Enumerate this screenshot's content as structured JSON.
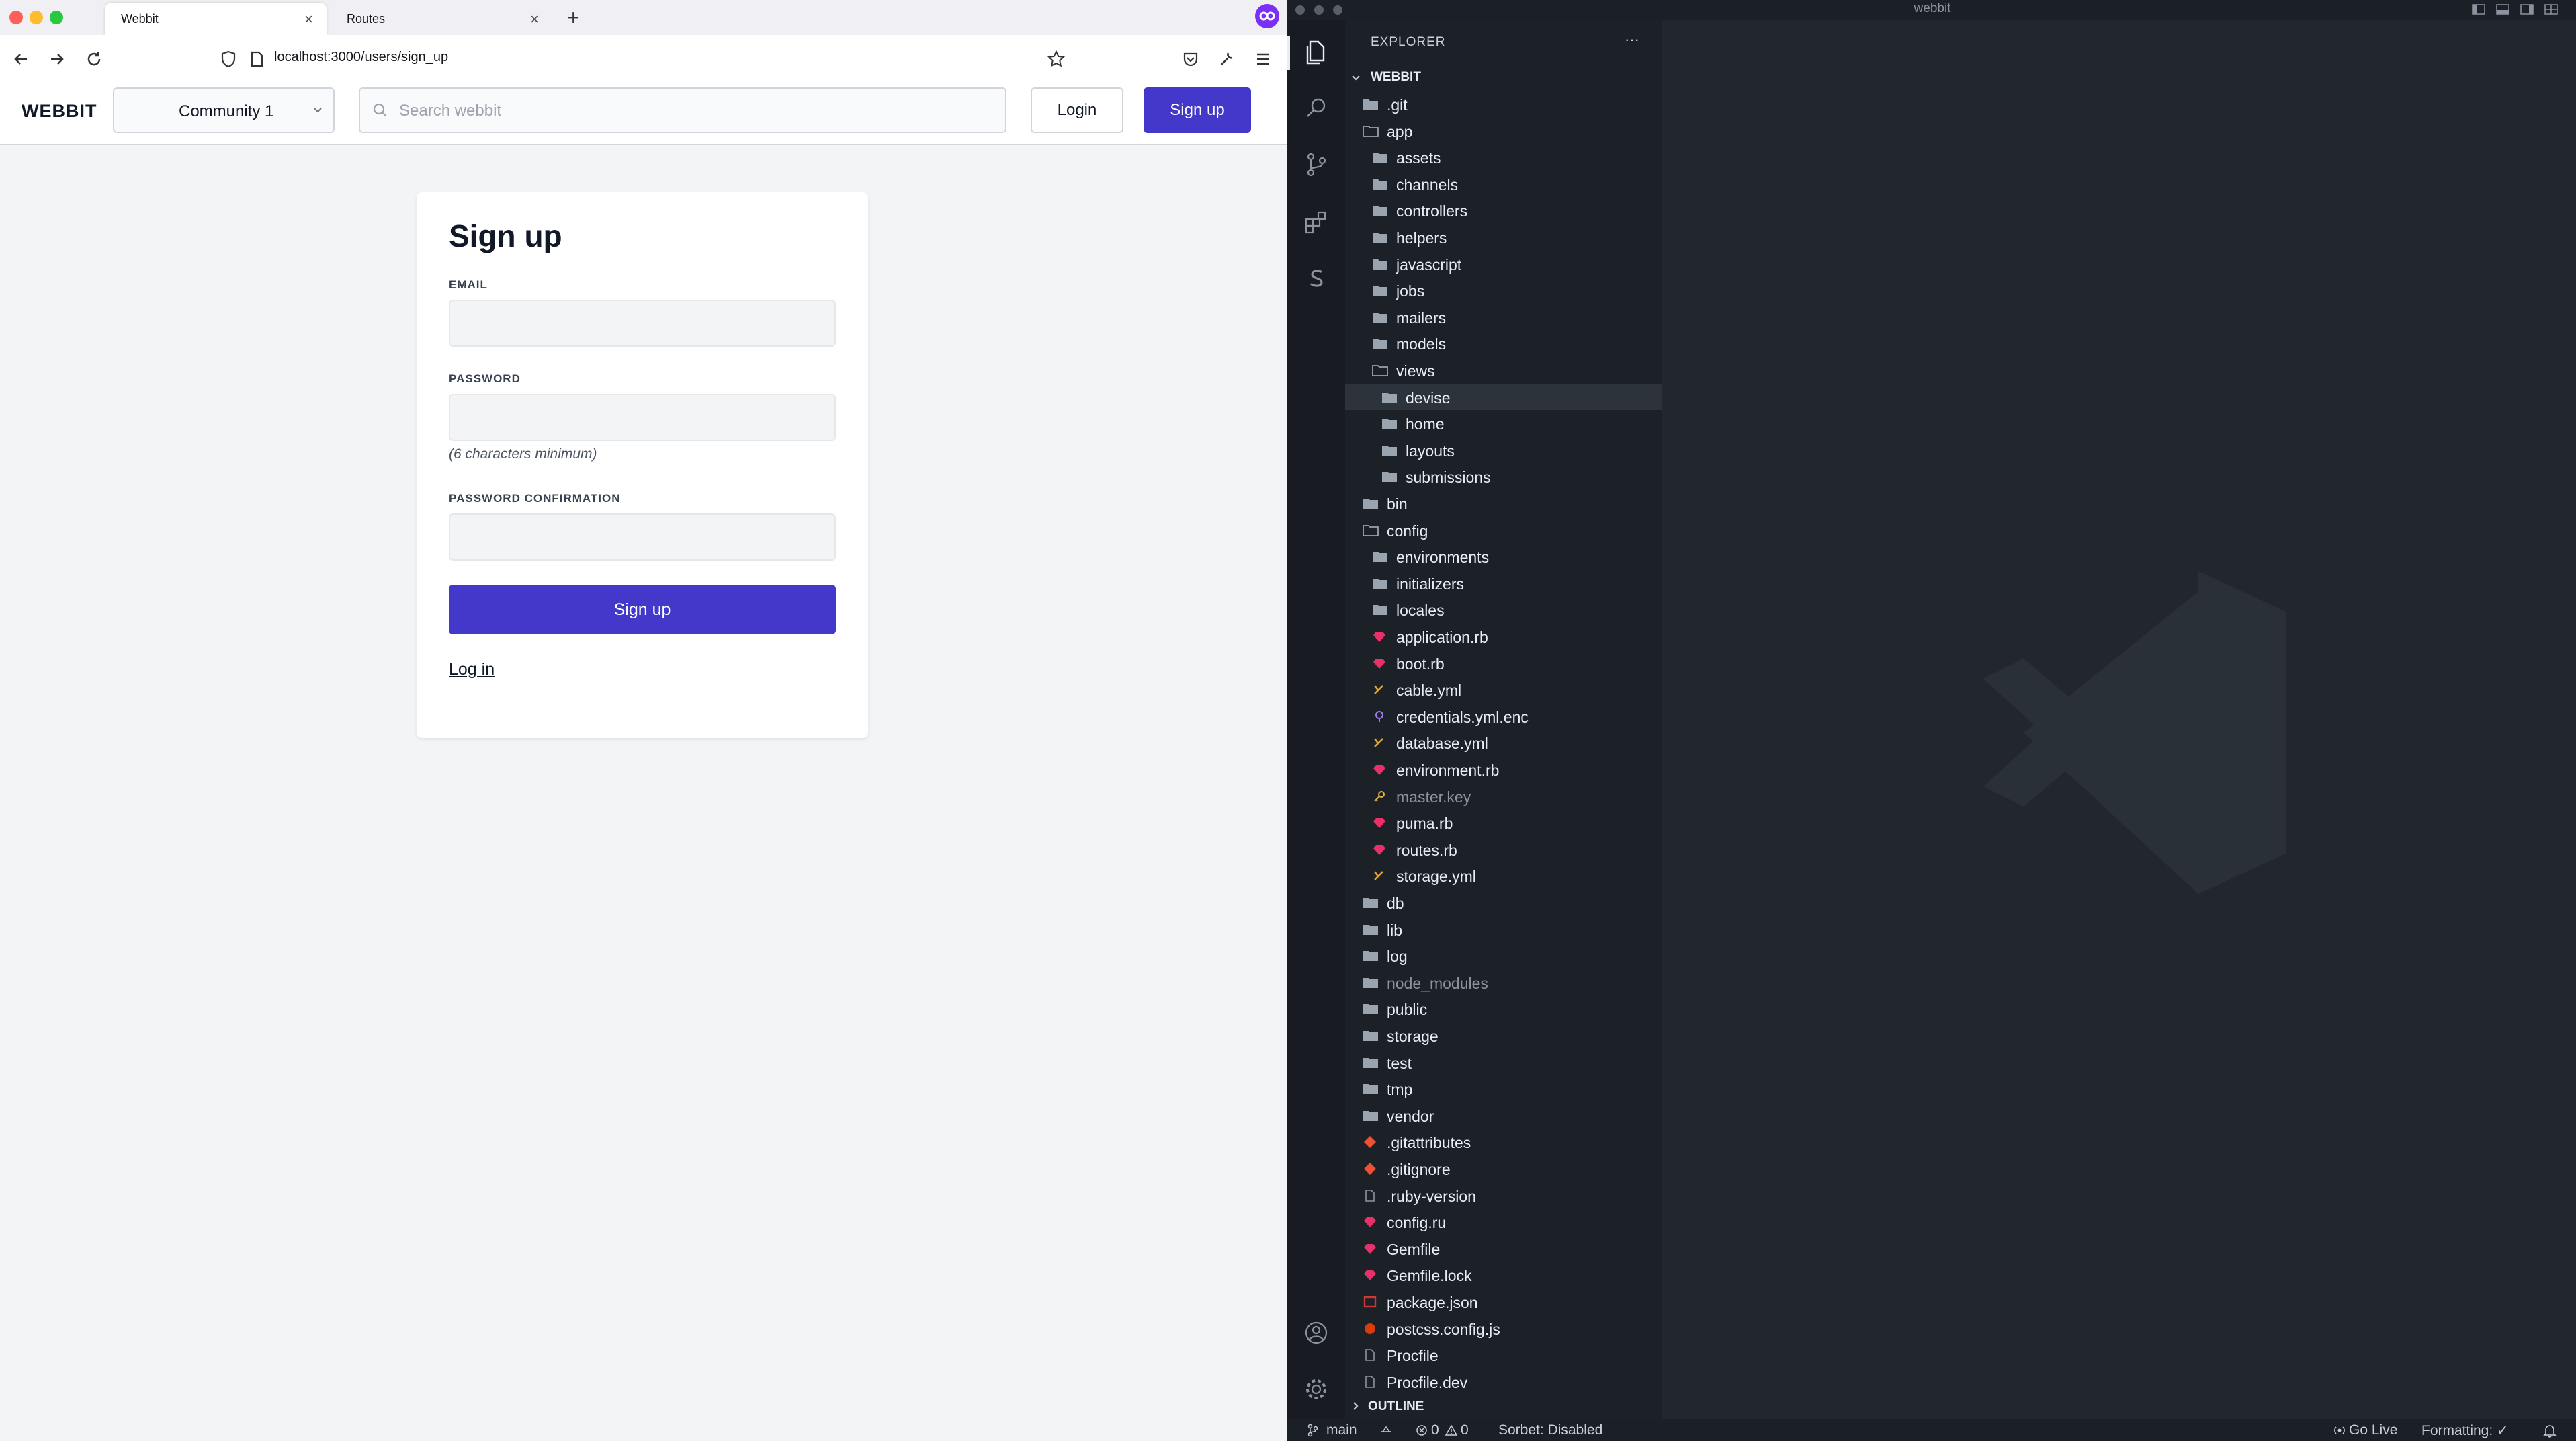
{
  "browser": {
    "tabs": [
      {
        "label": "Webbit",
        "active": true
      },
      {
        "label": "Routes",
        "active": false
      }
    ],
    "new_tab": "+",
    "url": "localhost:3000/users/sign_up"
  },
  "app": {
    "brand": "WEBBIT",
    "community_select": "Community 1",
    "search_placeholder": "Search webbit",
    "login_label": "Login",
    "signup_label": "Sign up",
    "accent_color": "#4338ca"
  },
  "form": {
    "title": "Sign up",
    "email_label": "EMAIL",
    "password_label": "PASSWORD",
    "password_hint": "(6 characters minimum)",
    "confirm_label": "PASSWORD CONFIRMATION",
    "submit_label": "Sign up",
    "login_link": "Log in"
  },
  "vscode": {
    "title": "webbit",
    "explorer_title": "EXPLORER",
    "explorer_more": "···",
    "root": "WEBBIT",
    "tree": [
      {
        "name": ".git",
        "indent": 1,
        "type": "folder"
      },
      {
        "name": "app",
        "indent": 1,
        "type": "folder-open"
      },
      {
        "name": "assets",
        "indent": 2,
        "type": "folder"
      },
      {
        "name": "channels",
        "indent": 2,
        "type": "folder"
      },
      {
        "name": "controllers",
        "indent": 2,
        "type": "folder"
      },
      {
        "name": "helpers",
        "indent": 2,
        "type": "folder"
      },
      {
        "name": "javascript",
        "indent": 2,
        "type": "folder"
      },
      {
        "name": "jobs",
        "indent": 2,
        "type": "folder"
      },
      {
        "name": "mailers",
        "indent": 2,
        "type": "folder"
      },
      {
        "name": "models",
        "indent": 2,
        "type": "folder"
      },
      {
        "name": "views",
        "indent": 2,
        "type": "folder-open"
      },
      {
        "name": "devise",
        "indent": 3,
        "type": "folder",
        "selected": true
      },
      {
        "name": "home",
        "indent": 3,
        "type": "folder"
      },
      {
        "name": "layouts",
        "indent": 3,
        "type": "folder"
      },
      {
        "name": "submissions",
        "indent": 3,
        "type": "folder"
      },
      {
        "name": "bin",
        "indent": 1,
        "type": "folder"
      },
      {
        "name": "config",
        "indent": 1,
        "type": "folder-open"
      },
      {
        "name": "environments",
        "indent": 2,
        "type": "folder"
      },
      {
        "name": "initializers",
        "indent": 2,
        "type": "folder"
      },
      {
        "name": "locales",
        "indent": 2,
        "type": "folder"
      },
      {
        "name": "application.rb",
        "indent": 2,
        "type": "ruby"
      },
      {
        "name": "boot.rb",
        "indent": 2,
        "type": "ruby"
      },
      {
        "name": "cable.yml",
        "indent": 2,
        "type": "yaml"
      },
      {
        "name": "credentials.yml.enc",
        "indent": 2,
        "type": "enc"
      },
      {
        "name": "database.yml",
        "indent": 2,
        "type": "yaml"
      },
      {
        "name": "environment.rb",
        "indent": 2,
        "type": "ruby"
      },
      {
        "name": "master.key",
        "indent": 2,
        "type": "key",
        "dim": true
      },
      {
        "name": "puma.rb",
        "indent": 2,
        "type": "ruby"
      },
      {
        "name": "routes.rb",
        "indent": 2,
        "type": "ruby"
      },
      {
        "name": "storage.yml",
        "indent": 2,
        "type": "yaml"
      },
      {
        "name": "db",
        "indent": 1,
        "type": "folder"
      },
      {
        "name": "lib",
        "indent": 1,
        "type": "folder"
      },
      {
        "name": "log",
        "indent": 1,
        "type": "folder"
      },
      {
        "name": "node_modules",
        "indent": 1,
        "type": "folder",
        "dim": true
      },
      {
        "name": "public",
        "indent": 1,
        "type": "folder"
      },
      {
        "name": "storage",
        "indent": 1,
        "type": "folder"
      },
      {
        "name": "test",
        "indent": 1,
        "type": "folder"
      },
      {
        "name": "tmp",
        "indent": 1,
        "type": "folder"
      },
      {
        "name": "vendor",
        "indent": 1,
        "type": "folder"
      },
      {
        "name": ".gitattributes",
        "indent": 1,
        "type": "git"
      },
      {
        "name": ".gitignore",
        "indent": 1,
        "type": "git"
      },
      {
        "name": ".ruby-version",
        "indent": 1,
        "type": "file"
      },
      {
        "name": "config.ru",
        "indent": 1,
        "type": "ruby"
      },
      {
        "name": "Gemfile",
        "indent": 1,
        "type": "gem"
      },
      {
        "name": "Gemfile.lock",
        "indent": 1,
        "type": "gem"
      },
      {
        "name": "package.json",
        "indent": 1,
        "type": "npm"
      },
      {
        "name": "postcss.config.js",
        "indent": 1,
        "type": "postcss"
      },
      {
        "name": "Procfile",
        "indent": 1,
        "type": "file"
      },
      {
        "name": "Procfile.dev",
        "indent": 1,
        "type": "file"
      }
    ],
    "outline": "OUTLINE",
    "status": {
      "branch": "main",
      "errors": "0",
      "warnings": "0",
      "sorbet": "Sorbet: Disabled",
      "golive": "Go Live",
      "formatting": "Formatting: ✓"
    }
  }
}
